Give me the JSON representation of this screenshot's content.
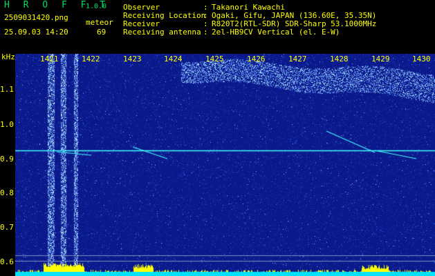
{
  "header": {
    "app_title": "H R O F F T",
    "app_version": "1.0.0",
    "file_name": "2509031420.png",
    "mode": "meteor",
    "datetime": "25.09.03 14:20",
    "count": "69",
    "info": [
      {
        "label": "Observer",
        "value": "Takanori Kawachi"
      },
      {
        "label": "Receiving Location",
        "value": "Ogaki, Gifu, JAPAN (136.60E, 35.35N)"
      },
      {
        "label": "Receiver",
        "value": "R820T2(RTL-SDR) SDR-Sharp 53.1000MHz"
      },
      {
        "label": "Receiving antenna",
        "value": "2el-HB9CV Vertical (el. E-W)"
      }
    ]
  },
  "spectrogram": {
    "y_unit": "kHz",
    "y_ticks": [
      "1.1",
      "1.0",
      "0.9",
      "0.8",
      "0.7",
      "0.6"
    ],
    "minute_labels": [
      "1421",
      "1422",
      "1423",
      "1424",
      "1425",
      "1426",
      "1427",
      "1428",
      "1429",
      "1430"
    ],
    "colors": {
      "background": "#0a1a8a",
      "noise": "#3050e0",
      "signal": "#40ffff",
      "header_text": "#00e060",
      "axis": "#ffff00"
    }
  }
}
